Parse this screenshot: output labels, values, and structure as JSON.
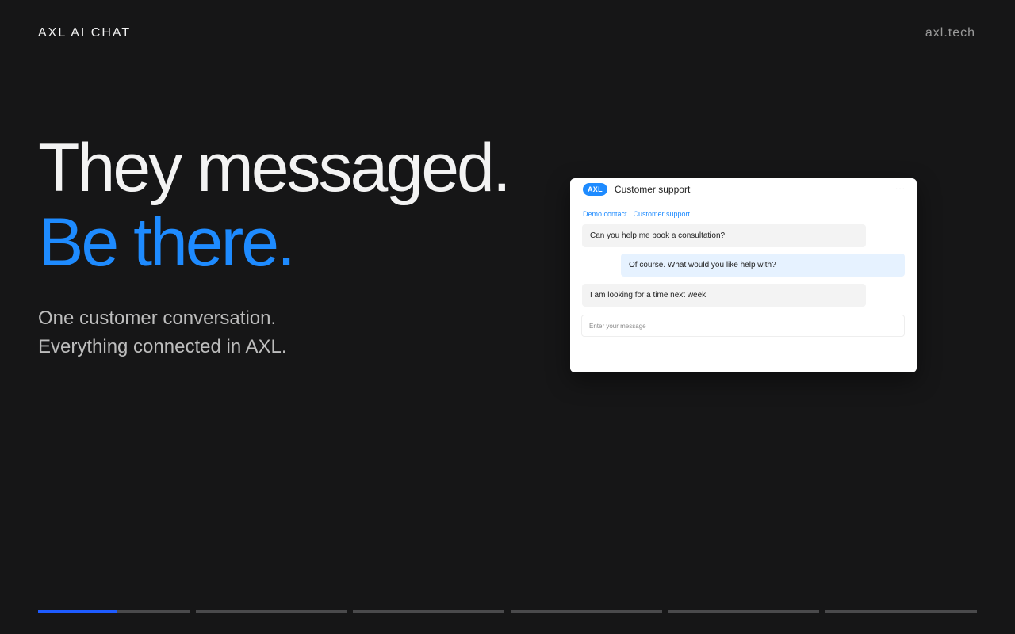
{
  "header": {
    "brand": "AXL AI CHAT",
    "site_link": "axl.tech"
  },
  "hero": {
    "headline_line1": "They messaged.",
    "headline_line2": "Be there.",
    "sub_line1": "One customer conversation.",
    "sub_line2": "Everything connected in AXL."
  },
  "chat": {
    "badge": "AXL",
    "title": "Customer support",
    "more_icon": "···",
    "breadcrumb": "Demo contact · Customer support",
    "messages": [
      {
        "direction": "incoming",
        "text": "Can you help me book a consultation?"
      },
      {
        "direction": "outgoing",
        "text": "Of course. What would you like help with?"
      },
      {
        "direction": "incoming",
        "text": "I am looking for a time next week."
      }
    ],
    "composer_placeholder": "Enter your message"
  },
  "progress": {
    "segments": 6,
    "active_index": 0,
    "active_fill": 0.52
  },
  "colors": {
    "background": "#161617",
    "accent": "#1e8bff",
    "progress_active": "#1e5bff"
  }
}
